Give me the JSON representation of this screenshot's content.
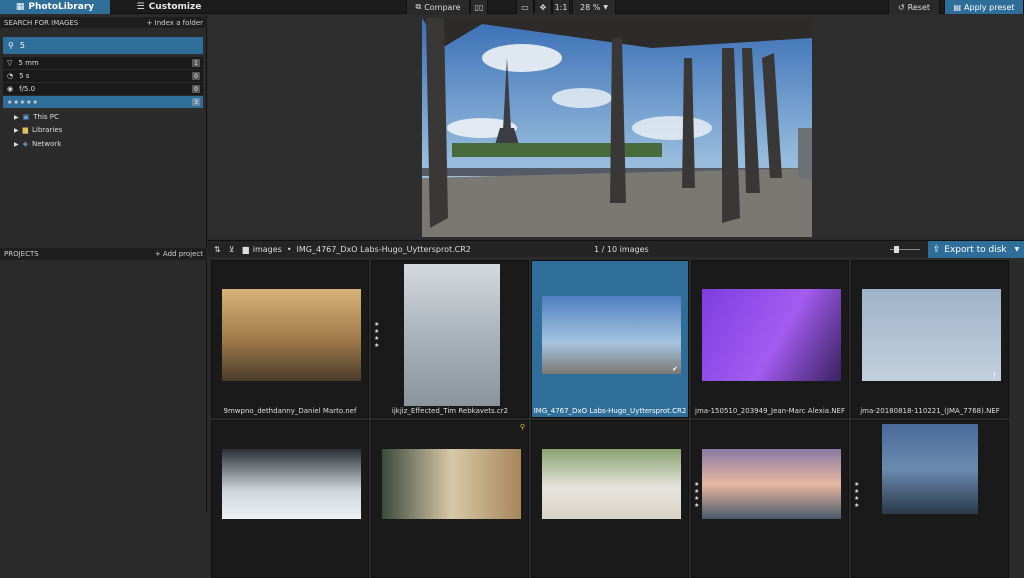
{
  "topbar": {
    "tab_photolibrary": "PhotoLibrary",
    "tab_customize": "Customize",
    "compare": "Compare",
    "zoom_1to1": "1:1",
    "zoom_level": "28 %",
    "reset": "Reset",
    "apply_preset": "Apply preset"
  },
  "search_panel": {
    "title": "SEARCH FOR IMAGES",
    "index_folder": "+ Index a folder",
    "query": "5",
    "filters": [
      {
        "label": "5 mm",
        "count": "1"
      },
      {
        "label": "5 s",
        "count": "0"
      },
      {
        "label": "f/5.0",
        "count": "0"
      },
      {
        "label": "★★★★★",
        "count": "3"
      }
    ],
    "tree": [
      "This PC",
      "Libraries",
      "Network"
    ]
  },
  "projects_panel": {
    "title": "PROJECTS",
    "add_project": "+ Add project"
  },
  "browser": {
    "folder": "images",
    "file": "IMG_4767_DxO Labs-Hugo_Uyttersprot.CR2",
    "count": "1 / 10  images",
    "export": "Export to disk"
  },
  "thumbnails": [
    {
      "name": "9mwpno_dethdanny_Daniel Marto.nef"
    },
    {
      "name": "ijkjiz_Effected_Tim Rebkavets.cr2"
    },
    {
      "name": "IMG_4767_DxO Labs-Hugo_Uyttersprot.CR2"
    },
    {
      "name": "jma-150510_203949_Jean-Marc Alexia.NEF"
    },
    {
      "name": "jma-20180818-110221_(JMA_7768).NEF"
    }
  ],
  "colors": {
    "accent": "#2e6e99",
    "bg": "#2b2b2b",
    "cell": "#1a1a1a"
  }
}
